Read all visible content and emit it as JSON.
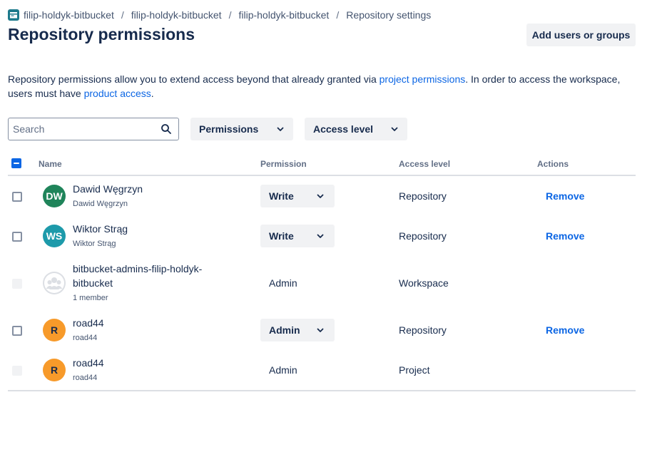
{
  "breadcrumb": {
    "items": [
      "filip-holdyk-bitbucket",
      "filip-holdyk-bitbucket",
      "filip-holdyk-bitbucket",
      "Repository settings"
    ],
    "separator": "/"
  },
  "page_title": "Repository permissions",
  "add_button": "Add users or groups",
  "description": {
    "text1": "Repository permissions allow you to extend access beyond that already granted via ",
    "link1": "project permissions",
    "text2": ". In order to access the workspace, users must have ",
    "link2": "product access",
    "text3": "."
  },
  "search": {
    "placeholder": "Search",
    "value": ""
  },
  "filters": {
    "permissions": "Permissions",
    "access_level": "Access level"
  },
  "table": {
    "headers": {
      "name": "Name",
      "permission": "Permission",
      "access_level": "Access level",
      "actions": "Actions"
    },
    "rows": [
      {
        "initials": "DW",
        "avatar_color": "#1f845a",
        "name": "Dawid Węgrzyn",
        "sub": "Dawid Węgrzyn",
        "permission": "Write",
        "access": "Repository",
        "action": "Remove"
      },
      {
        "initials": "WS",
        "avatar_color": "#1d9aaa",
        "name": "Wiktor Strąg",
        "sub": "Wiktor Strąg",
        "permission": "Write",
        "access": "Repository",
        "action": "Remove"
      },
      {
        "avatar_icon": "group-icon",
        "name_line1": "bitbucket-admins-filip-holdyk-",
        "name_line2": "bitbucket",
        "sub": "1 member",
        "permission": "Admin",
        "access": "Workspace"
      },
      {
        "initials": "R",
        "avatar_color": "#f79a2a",
        "name": "road44",
        "sub": "road44",
        "permission": "Admin",
        "access": "Repository",
        "action": "Remove"
      },
      {
        "initials": "R",
        "avatar_color": "#f79a2a",
        "name": "road44",
        "sub": "road44",
        "permission": "Admin",
        "access": "Project"
      }
    ]
  },
  "colors": {
    "link": "#0c66e4",
    "text": "#172b4d",
    "button_bg": "#f1f2f4"
  }
}
